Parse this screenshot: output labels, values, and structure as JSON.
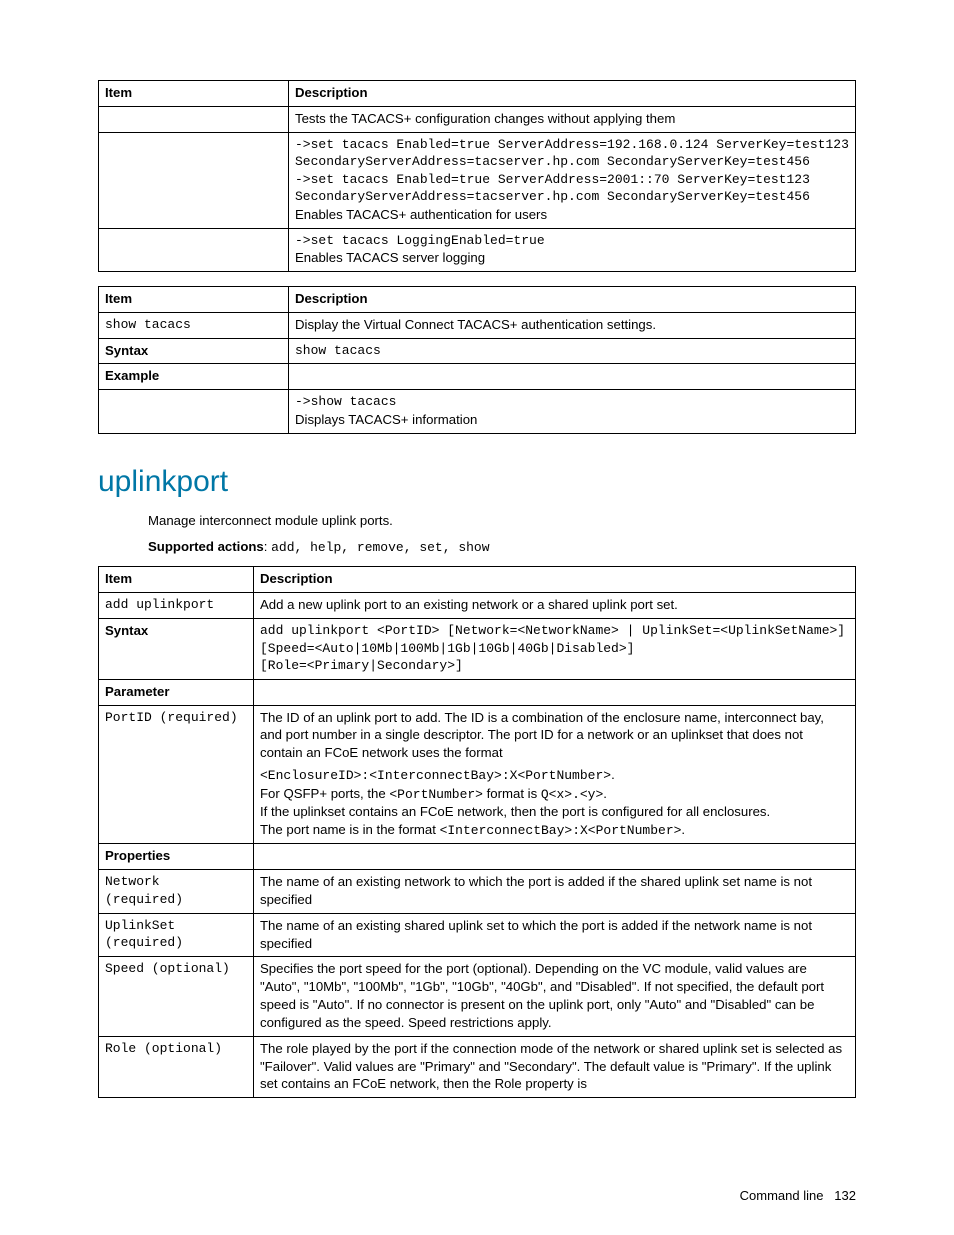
{
  "table1": {
    "head": {
      "item": "Item",
      "desc": "Description"
    },
    "row1_desc": "Tests the TACACS+ configuration changes without applying them",
    "row2_cmd1": "->set tacacs Enabled=true ServerAddress=192.168.0.124 ServerKey=test123 SecondaryServerAddress=tacserver.hp.com SecondaryServerKey=test456",
    "row2_cmd2": "->set tacacs Enabled=true ServerAddress=2001::70 ServerKey=test123 SecondaryServerAddress=tacserver.hp.com SecondaryServerKey=test456",
    "row2_note": "Enables TACACS+ authentication for users",
    "row3_cmd": "->set tacacs LoggingEnabled=true",
    "row3_note": "Enables TACACS server logging"
  },
  "table2": {
    "head": {
      "item": "Item",
      "desc": "Description"
    },
    "row1_item": "show tacacs",
    "row1_desc": "Display the Virtual Connect TACACS+ authentication settings.",
    "row2_item": "Syntax",
    "row2_desc": "show tacacs",
    "row3_item": "Example",
    "row4_cmd": "->show tacacs",
    "row4_note": "Displays TACACS+ information"
  },
  "section": {
    "title": "uplinkport",
    "intro": "Manage interconnect module uplink ports.",
    "supported_label": "Supported actions",
    "supported_actions": "add, help, remove, set, show"
  },
  "table3": {
    "head": {
      "item": "Item",
      "desc": "Description"
    },
    "r1_item": "add uplinkport",
    "r1_desc": "Add a new uplink port to an existing network or a shared uplink port set.",
    "r2_item": "Syntax",
    "r2_desc": "add uplinkport <PortID> [Network=<NetworkName> | UplinkSet=<UplinkSetName>]\n[Speed=<Auto|10Mb|100Mb|1Gb|10Gb|40Gb|Disabled>]\n[Role=<Primary|Secondary>]",
    "r3_item": "Parameter",
    "r4_item": "PortID (required)",
    "r4_p1": "The ID of an uplink port to add. The ID is a combination of the enclosure name, interconnect bay, and port number in a single descriptor. The port ID for a network or an uplinkset that does not contain an FCoE network uses the format",
    "r4_code1": "<EnclosureID>:<InterconnectBay>:X<PortNumber>",
    "r4_p2a": "For QSFP+ ports, the ",
    "r4_codeA": "<PortNumber>",
    "r4_p2b": " format is ",
    "r4_codeB": "Q<x>.<y>",
    "r4_p3": "If the uplinkset contains an FCoE network, then the port is configured for all enclosures.",
    "r4_p4a": "The port name is in the format ",
    "r4_code2": "<InterconnectBay>:X<PortNumber>",
    "r5_item": "Properties",
    "r6_item": "Network (required)",
    "r6_desc": "The name of an existing network to which the port is added if the shared uplink set name is not specified",
    "r7_item": "UplinkSet (required)",
    "r7_desc": "The name of an existing shared uplink set to which the port is added if the network name is not specified",
    "r8_item": "Speed (optional)",
    "r8_desc": "Specifies the port speed for the port (optional). Depending on the VC module, valid values are \"Auto\", \"10Mb\", \"100Mb\", \"1Gb\", \"10Gb\", \"40Gb\", and \"Disabled\". If not specified, the default port speed is \"Auto\". If no connector is present on the uplink port, only \"Auto\" and \"Disabled\" can be configured as the speed. Speed restrictions apply.",
    "r9_item": "Role (optional)",
    "r9_desc": "The role played by the port if the connection mode of the network or shared uplink set is selected as \"Failover\". Valid values are \"Primary\" and \"Secondary\". The default value is \"Primary\". If the uplink set contains an FCoE network, then the Role property is"
  },
  "footer": {
    "label": "Command line",
    "page": "132"
  }
}
